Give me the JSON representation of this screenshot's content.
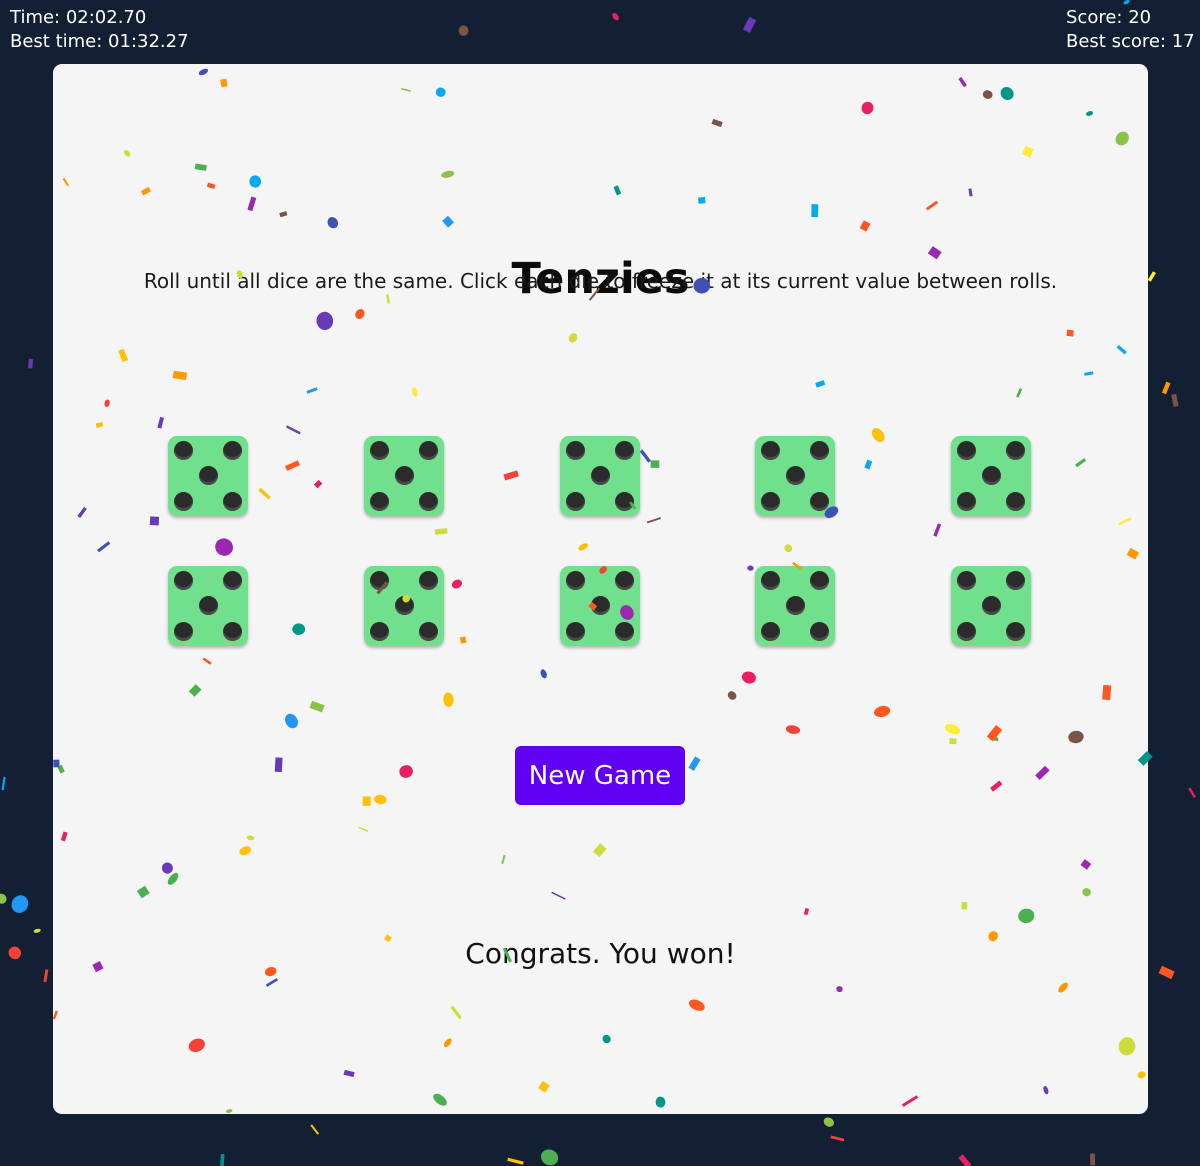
{
  "hud": {
    "time": "Time: 02:02.70",
    "best_time": "Best time: 01:32.27",
    "score": "Score: 20",
    "best_score": "Best score: 17"
  },
  "game": {
    "title": "Tenzies",
    "instructions": "Roll until all dice are the same. Click each die to freeze it at its current value between rolls.",
    "dice": [
      5,
      5,
      5,
      5,
      5,
      5,
      5,
      5,
      5,
      5
    ],
    "new_game_label": "New Game",
    "status": "Congrats. You won!"
  },
  "colors": {
    "background": "#131f33",
    "board": "#f5f5f5",
    "die": "#71e08d",
    "pip": "#2b2b2b",
    "button": "#5f00f2"
  },
  "confetti_colors": [
    "#ffc107",
    "#f44336",
    "#2196f3",
    "#4caf50",
    "#9c27b0",
    "#ff9800",
    "#8bc34a",
    "#e91e63",
    "#009688",
    "#673ab7",
    "#03a9f4",
    "#cddc39",
    "#795548",
    "#ffeb3b",
    "#3f51b5",
    "#ff5722"
  ]
}
